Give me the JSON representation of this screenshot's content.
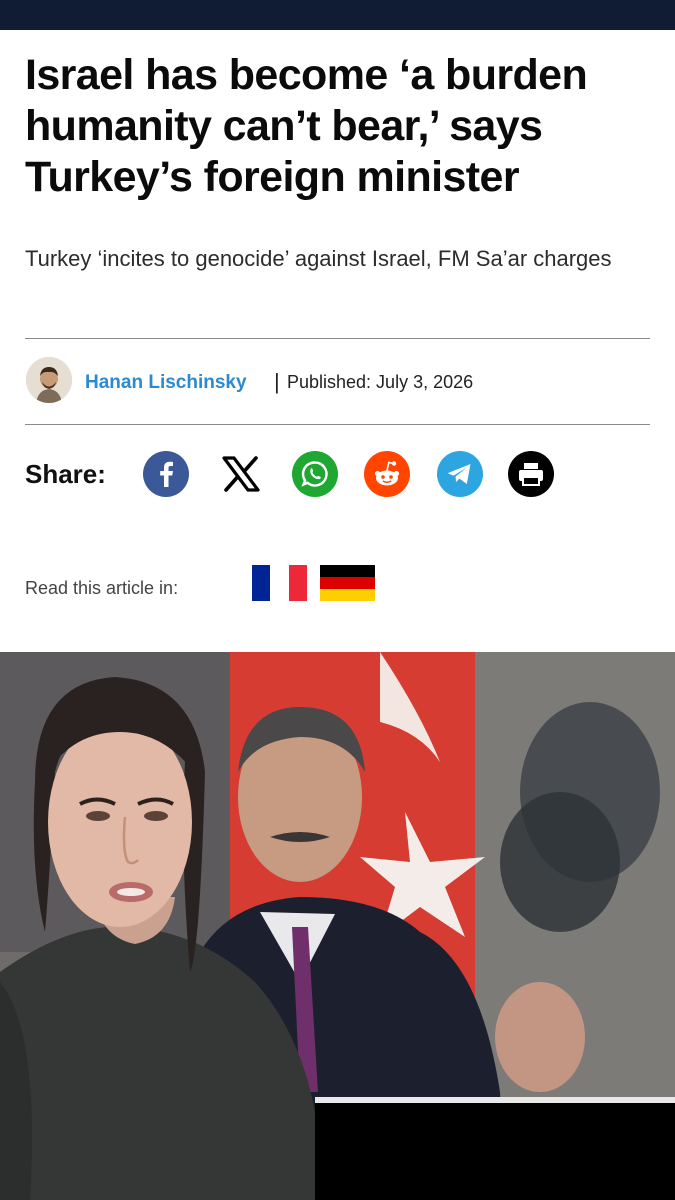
{
  "article": {
    "headline": "Israel has become ‘a burden humanity can’t bear,’ says Turkey’s foreign minister",
    "subheadline": "Turkey ‘incites to genocide’ against Israel, FM Sa’ar charges",
    "author": "Hanan Lischinsky",
    "separator": "|",
    "published": "Published: July 3, 2026"
  },
  "share": {
    "label": "Share:",
    "buttons": [
      {
        "name": "facebook",
        "color": "#3b5998"
      },
      {
        "name": "x",
        "color": "#000000"
      },
      {
        "name": "whatsapp",
        "color": "#1ea831"
      },
      {
        "name": "reddit",
        "color": "#ff4500"
      },
      {
        "name": "telegram",
        "color": "#2ca5e0"
      },
      {
        "name": "print",
        "color": "#000000"
      }
    ]
  },
  "translations": {
    "label": "Read this article in:",
    "languages": [
      "french-flag",
      "german-flag"
    ]
  },
  "colors": {
    "topbar": "#101c33",
    "author_link": "#2b8ad0"
  }
}
